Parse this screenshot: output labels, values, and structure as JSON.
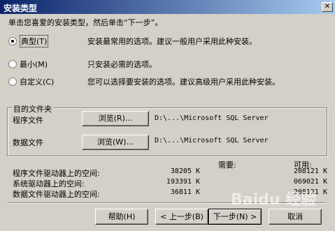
{
  "window": {
    "title": "安装类型",
    "close_glyph": "✕"
  },
  "instruction": "单击您喜爱的安装类型，然后单击“下一步”。",
  "options": [
    {
      "label": "典型(T)",
      "desc": "安装最常用的选项。建议一般用户采用此种安装。",
      "selected": true
    },
    {
      "label": "最小(M)",
      "desc": "只安装必需的选项。",
      "selected": false
    },
    {
      "label": "自定义(C)",
      "desc": "您可以选择要安装的选项。建议高级用户采用此种安装。",
      "selected": false
    }
  ],
  "destination": {
    "group_title": "目的文件夹",
    "program_label": "程序文件",
    "program_browse": "浏览(R)...",
    "program_path": "D:\\...\\Microsoft SQL Server",
    "data_label": "数据文件",
    "data_browse": "浏览(W)...",
    "data_path": "D:\\...\\Microsoft SQL Server"
  },
  "space": {
    "required_header": "需要:",
    "available_header": "可用:",
    "rows": [
      {
        "label": "程序文件驱动器上的空间:",
        "required": "38205 K",
        "available": "208121 K"
      },
      {
        "label": "系统驱动器上的空间:",
        "required": "193391 K",
        "available": "069021 K"
      },
      {
        "label": "数据文件驱动器上的空间:",
        "required": "36811 K",
        "available": "208121 K"
      }
    ]
  },
  "buttons": {
    "help": "帮助(H)",
    "back": "< 上一步(B)",
    "next": "下一步(N) >",
    "cancel": "取消"
  },
  "watermark": "Baidu 经验"
}
